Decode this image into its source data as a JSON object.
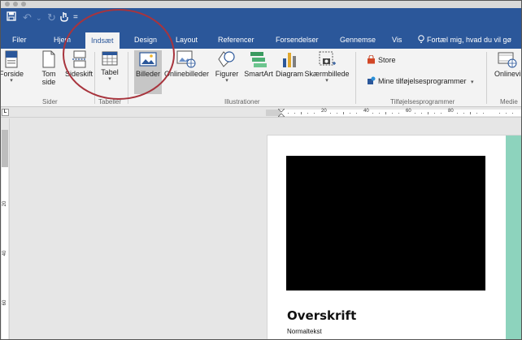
{
  "quick_access": {
    "save_icon": "save-icon",
    "undo_icon": "undo-icon",
    "redo_icon": "redo-icon",
    "touch_icon": "touch-mode-icon",
    "customize": "="
  },
  "tabs": [
    {
      "label": "Filer"
    },
    {
      "label": "Hjem"
    },
    {
      "label": "Indsæt",
      "active": true
    },
    {
      "label": "Design"
    },
    {
      "label": "Layout"
    },
    {
      "label": "Referencer"
    },
    {
      "label": "Forsendelser"
    },
    {
      "label": "Gennemse"
    },
    {
      "label": "Vis"
    }
  ],
  "tell_me": {
    "label": "Fortæl mig, hvad du vil gø"
  },
  "ribbon": {
    "pages_group": {
      "label": "Sider",
      "cover": "Forside",
      "blank_line1": "Tom",
      "blank_line2": "side",
      "page_break": "Sideskift"
    },
    "tables_group": {
      "label": "Tabeller",
      "table": "Tabel"
    },
    "illustrations_group": {
      "label": "Illustrationer",
      "pictures": "Billeder",
      "online_pictures": "Onlinebilleder",
      "shapes": "Figurer",
      "smartart": "SmartArt",
      "chart": "Diagram",
      "screenshot": "Skærmbillede"
    },
    "addins_group": {
      "label": "Tilføjelsesprogrammer",
      "store": "Store",
      "my_addins": "Mine tilføjelsesprogrammer"
    },
    "media_group": {
      "label": "Medie",
      "online_video": "Onlinevi"
    }
  },
  "ruler": {
    "tab_stop": "L",
    "h_numbers": [
      "20",
      "40",
      "60",
      "80"
    ],
    "v_numbers": [
      "20",
      "40",
      "60"
    ]
  },
  "document": {
    "heading": "Overskrift",
    "body": "Normaltekst"
  },
  "colors": {
    "title_bar": "#2b579a",
    "ribbon": "#f3f3f3",
    "accent_bar": "#8dd3bd",
    "highlight_circle": "#a8343d"
  }
}
